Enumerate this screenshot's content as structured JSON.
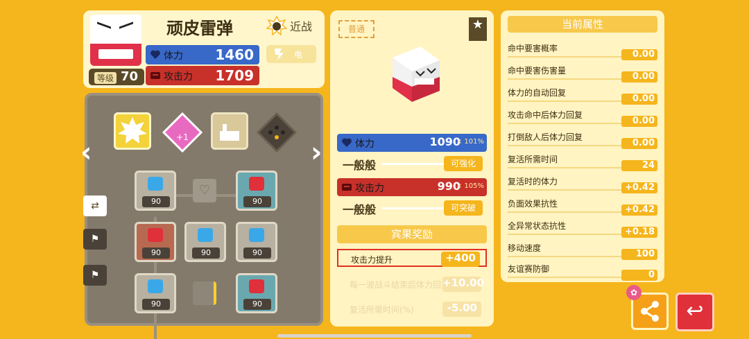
{
  "pokemon": {
    "name": "顽皮雷弹",
    "level_label": "等级",
    "level": "70",
    "range": "近战",
    "type": "电",
    "hp_label": "体力",
    "hp": "1460",
    "atk_label": "攻击力",
    "atk": "1709"
  },
  "stones": {
    "grid": [
      {
        "kind": "blue",
        "value": "90"
      },
      {
        "kind": "red",
        "value": "90"
      },
      {
        "kind": "copper",
        "value": "90"
      },
      {
        "kind": "blue",
        "value": "90"
      },
      {
        "kind": "blue",
        "value": "90"
      },
      {
        "kind": "blue",
        "value": "90"
      },
      {
        "kind": "red",
        "value": "90"
      }
    ]
  },
  "detail": {
    "rarity": "普通",
    "hp_label": "体力",
    "hp_value": "1090",
    "hp_pct": "× 101%",
    "hp_grade": "一般般",
    "hp_action": "可强化",
    "atk_label": "攻击力",
    "atk_value": "990",
    "atk_pct": "× 105%",
    "atk_grade": "一般般",
    "atk_action": "可突破",
    "bingo_header": "宾果奖励",
    "bonuses": [
      {
        "label": "攻击力提升",
        "value": "+400"
      },
      {
        "label": "每一波战斗结束后体力回复(%)",
        "value": "+10.00"
      },
      {
        "label": "复活所需时间(%)",
        "value": "-5.00"
      }
    ]
  },
  "attributes": {
    "title": "当前属性",
    "rows": [
      {
        "label": "命中要害概率",
        "value": "0.00"
      },
      {
        "label": "命中要害伤害量",
        "value": "0.00"
      },
      {
        "label": "体力的自动回复",
        "value": "0.00"
      },
      {
        "label": "攻击命中后体力回复",
        "value": "0.00"
      },
      {
        "label": "打倒敌人后体力回复",
        "value": "0.00"
      },
      {
        "label": "复活所需时间",
        "value": "24"
      },
      {
        "label": "复活时的体力",
        "value": "+0.42"
      },
      {
        "label": "负面效果抗性",
        "value": "+0.42"
      },
      {
        "label": "全异常状态抗性",
        "value": "+0.18"
      },
      {
        "label": "移动速度",
        "value": "100"
      },
      {
        "label": "友谊赛防御",
        "value": "0"
      }
    ]
  },
  "colors": {
    "background": "#f5b51c",
    "panel": "#fff4c2",
    "hp": "#3868c8",
    "atk": "#c8302a",
    "highlight_border": "#e03020"
  }
}
